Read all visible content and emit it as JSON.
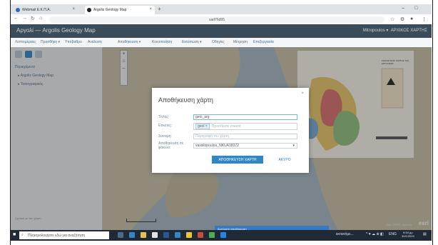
{
  "browser": {
    "tabs": [
      {
        "label": "Webmail E.K.Π.A."
      },
      {
        "label": "Argolis Geology Map"
      }
    ],
    "url": "sad76d95"
  },
  "app": {
    "title": "Αργολί — Argolis Geology Map",
    "user": "Mitropoulos ▾",
    "user2": "ΑΡΧΙΚΟΣ ΧΑΡΤΗΣ",
    "toolbar": [
      "Λεπτομέρειες",
      "Προσθήκη ▾",
      "Υπόβαθρο",
      "Ανάλυση",
      "Αποθήκευση ▾",
      "Κοινοποίηση",
      "Εκτύπωση ▾",
      "Οδηγίες",
      "Μέτρηση",
      "Επεξεργασία"
    ]
  },
  "sidebar": {
    "section_label": "Περιεχόμενα",
    "layers": [
      {
        "label": "Argolis Geology Map"
      },
      {
        "label": "Τοπογραφικός"
      }
    ],
    "footer": "Σχετικά με τον χάρτη"
  },
  "map": {
    "geo_title": "ΓΕΩΛΟΓΙΚΟΣ ΧΑΡΤΗΣ ΤΗΣ ΑΡΓΟΛΙΔΑΣ",
    "attribution": "Esri, HERE, Garmin",
    "logo": "esri"
  },
  "modal": {
    "title": "Αποθήκευση χάρτη",
    "close": "×",
    "fields": {
      "title_label": "Τίτλος:",
      "title_value": "geol_arg",
      "tags_label": "Ετικέτες:",
      "tag": "geol",
      "tags_placeholder": "Προσθέστε ετικέτα",
      "summary_label": "Σύνοψη:",
      "summary_placeholder": "Περιγραφή του χάρτη",
      "folder_label": "Αποθήκευση σε φάκελο:",
      "folder_value": "vassilopoulou_NKUA18372"
    },
    "save_button": "ΑΠΟΘΗΚΕΥΣΗ ΧΑΡΤΗ",
    "cancel_button": "ΑΚΥΡΟ"
  },
  "taskbar": {
    "search_placeholder": "Πληκτρολογήστε εδώ για αναζήτηση",
    "notification": "Αυτόματη αποθήκευση",
    "time": "8:54 μμ",
    "date": "30/1/2020",
    "lang": "ENG",
    "nearby_label": "εκτεινόμε..."
  },
  "colors": {
    "accent": "#2f86c9",
    "header": "#3a4b5a"
  }
}
